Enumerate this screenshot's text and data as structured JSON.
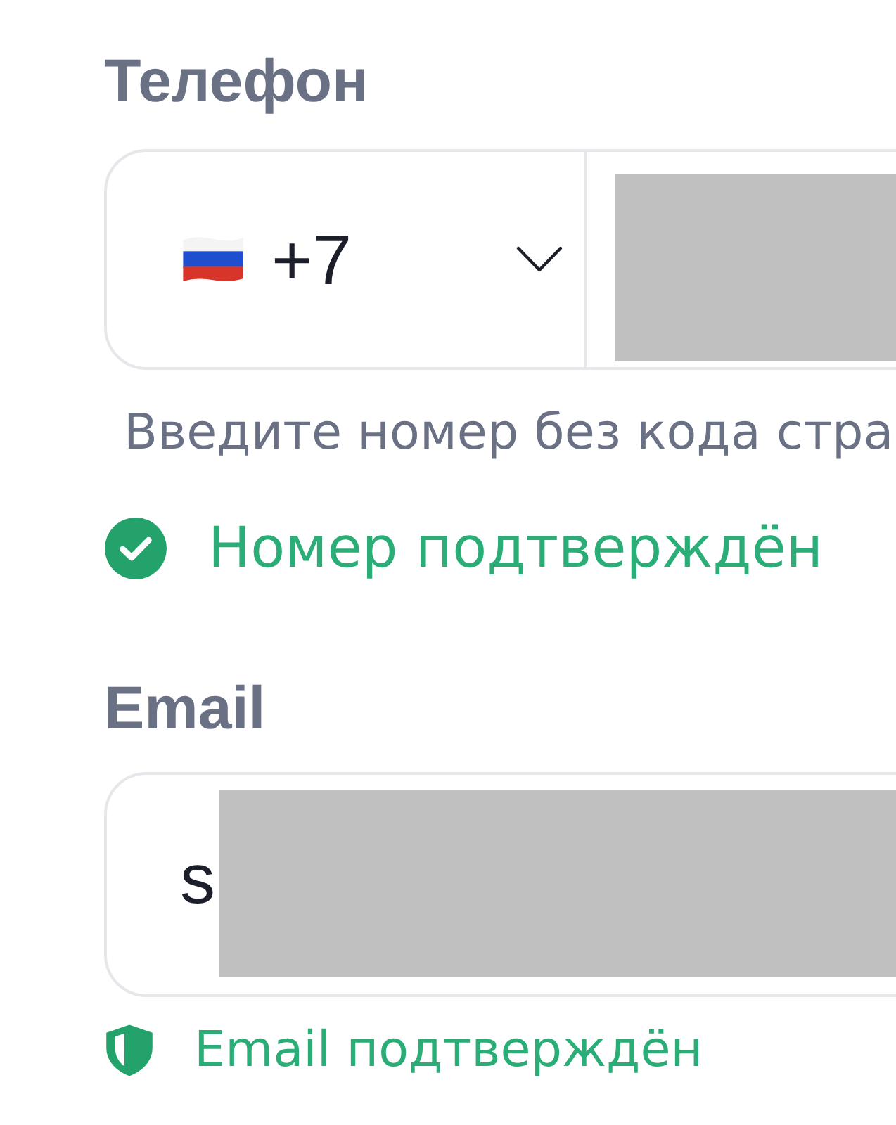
{
  "phone": {
    "label": "Телефон",
    "country_code": "+7",
    "hint": "Введите номер без кода стра",
    "status": {
      "text": "Номер подтверждён",
      "verified": true
    }
  },
  "email": {
    "label": "Email",
    "value": "s",
    "status": {
      "text": "Email подтверждён",
      "verified": true
    }
  }
}
